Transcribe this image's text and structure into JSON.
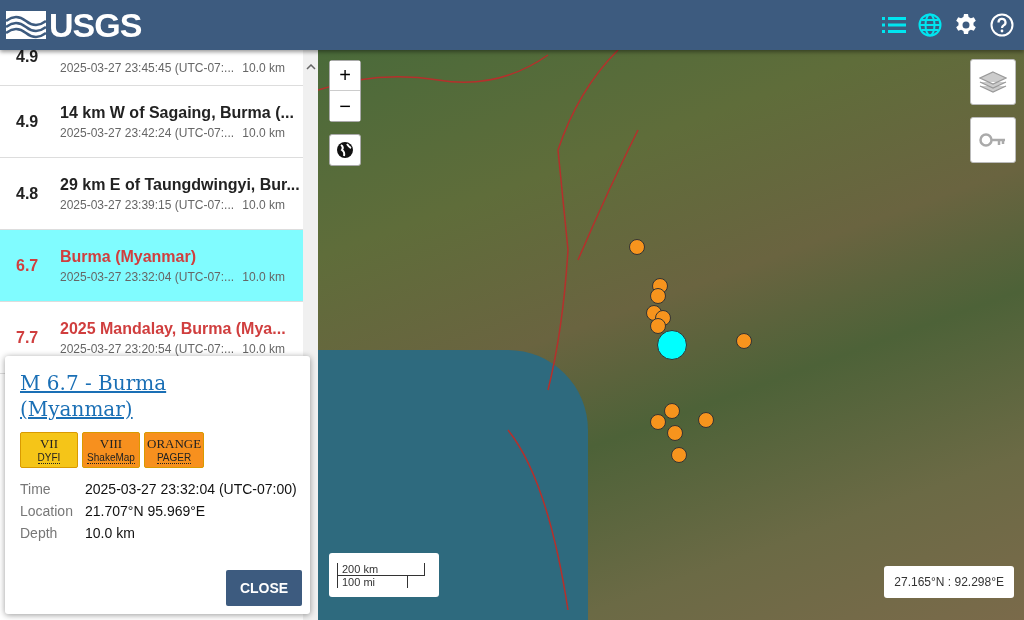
{
  "header": {
    "logo": "USGS",
    "buttons": [
      {
        "kind": "list",
        "selected": true
      },
      {
        "kind": "map",
        "selected": true
      },
      {
        "kind": "settings",
        "selected": false
      },
      {
        "kind": "help",
        "selected": false
      }
    ]
  },
  "list": {
    "rows": [
      {
        "mag": "4.9",
        "title": "",
        "time": "2025-03-27 23:45:45 (UTC-07:...",
        "depth": "10.0 km",
        "selected": false,
        "significant": false
      },
      {
        "mag": "4.9",
        "title": "14 km W of Sagaing, Burma (...",
        "time": "2025-03-27 23:42:24 (UTC-07:...",
        "depth": "10.0 km",
        "selected": false,
        "significant": false
      },
      {
        "mag": "4.8",
        "title": "29 km E of Taungdwingyi, Bur...",
        "time": "2025-03-27 23:39:15 (UTC-07:...",
        "depth": "10.0 km",
        "selected": false,
        "significant": false
      },
      {
        "mag": "6.7",
        "title": "Burma (Myanmar)",
        "time": "2025-03-27 23:32:04 (UTC-07:...",
        "depth": "10.0 km",
        "selected": true,
        "significant": true
      },
      {
        "mag": "7.7",
        "title": "2025 Mandalay, Burma (Mya...",
        "time": "2025-03-27 23:20:54 (UTC-07:...",
        "depth": "10.0 km",
        "selected": false,
        "significant": true
      }
    ]
  },
  "popup": {
    "title": "M 6.7 - Burma (Myanmar)",
    "badges": [
      {
        "value": "VII",
        "label": "DYFI",
        "color": "#f5c518"
      },
      {
        "value": "VIII",
        "label": "ShakeMap",
        "color": "#f7901e"
      },
      {
        "value": "ORANGE",
        "label": "PAGER",
        "color": "#f7901e"
      }
    ],
    "details": [
      {
        "label": "Time",
        "value": "2025-03-27 23:32:04 (UTC-07:00)"
      },
      {
        "label": "Location",
        "value": "21.707°N 95.969°E"
      },
      {
        "label": "Depth",
        "value": "10.0 km"
      }
    ],
    "close": "CLOSE"
  },
  "map": {
    "zoom_in": "+",
    "zoom_out": "−",
    "scale": {
      "metric": "200 km",
      "imperial": "100 mi"
    },
    "coordinates": "27.165°N : 92.298°E",
    "markers": [
      {
        "color": "#f7941d",
        "selected": false
      },
      {
        "color": "#f7941d",
        "selected": false
      },
      {
        "color": "#f7941d",
        "selected": false
      },
      {
        "color": "#f7941d",
        "selected": false
      },
      {
        "color": "#f7941d",
        "selected": false
      },
      {
        "color": "#f7941d",
        "selected": false
      },
      {
        "color": "#f7941d",
        "selected": false
      },
      {
        "color": "#f7941d",
        "selected": false
      },
      {
        "color": "#f7941d",
        "selected": false
      },
      {
        "color": "#f7941d",
        "selected": false
      },
      {
        "color": "#f7941d",
        "selected": false
      },
      {
        "color": "#f7941d",
        "selected": false
      },
      {
        "color": "#00ffff",
        "selected": true
      }
    ]
  }
}
